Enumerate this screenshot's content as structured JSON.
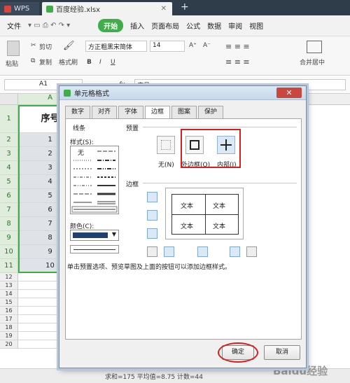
{
  "app": {
    "brand": "WPS",
    "file_tab": "百度经验.xlsx"
  },
  "menu": [
    "文件",
    "开始",
    "插入",
    "页面布局",
    "公式",
    "数据",
    "审阅",
    "视图"
  ],
  "ribbon": {
    "paste": "粘贴",
    "cut": "剪切",
    "copy": "复制",
    "format_painter": "格式刷",
    "font_name": "方正粗黑宋简体",
    "font_size": "14",
    "merge": "合并居中",
    "bold": "B",
    "italic": "I",
    "underline": "U",
    "grow_font": "A⁺",
    "shrink_font": "A⁻"
  },
  "formula_bar": {
    "cell_ref": "A1",
    "fx": "fx",
    "value": "序号"
  },
  "sheet": {
    "header_cell": "序号",
    "column_header": "A",
    "row_numbers": [
      "1",
      "2",
      "3",
      "4",
      "5",
      "6",
      "7",
      "8",
      "9",
      "10",
      "11",
      "12",
      "13",
      "14",
      "15",
      "16",
      "17",
      "18",
      "19",
      "20"
    ],
    "values": [
      "1",
      "2",
      "3",
      "4",
      "5",
      "6",
      "7",
      "8",
      "9",
      "10"
    ]
  },
  "status": "求和=175  平均值=8.75  计数=44",
  "watermark": "Baidu经验",
  "dialog": {
    "title": "单元格格式",
    "close": "✕",
    "tabs": [
      "数字",
      "对齐",
      "字体",
      "边框",
      "图案",
      "保护"
    ],
    "active_tab": "边框",
    "line_section": "线条",
    "style_label": "样式(S):",
    "none_style": "无",
    "color_label": "颜色(C):",
    "preset_section": "预置",
    "presets": [
      "无(N)",
      "外边框(O)",
      "内部(I)"
    ],
    "border_section": "边框",
    "preview_text": [
      "文本",
      "文本",
      "文本",
      "文本"
    ],
    "hint": "单击预置选项、预览草图及上面的按钮可以添加边框样式。",
    "ok": "确定",
    "cancel": "取消",
    "colors": {
      "accent": "#d71f1f",
      "line_color": "#1f3f73"
    }
  }
}
